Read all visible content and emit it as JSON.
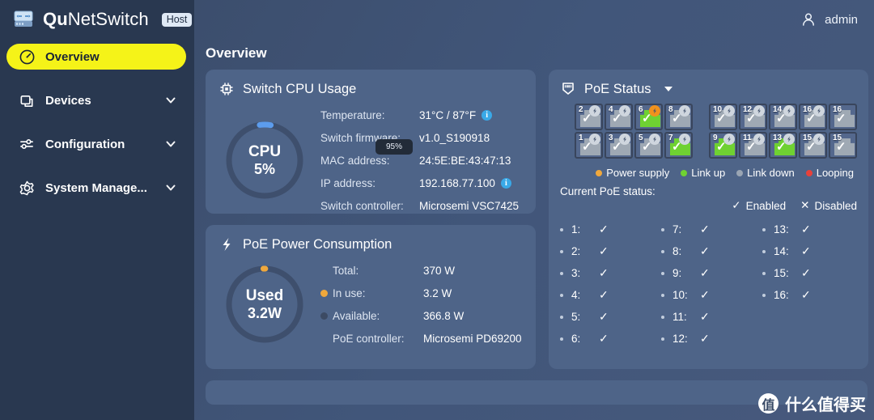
{
  "brand": {
    "name_bold": "Qu",
    "name_rest": "NetSwitch",
    "badge": "Host",
    "logo_icon": "switch-device-icon"
  },
  "sidebar": {
    "items": [
      {
        "label": "Overview",
        "icon": "gauge-icon",
        "active": true,
        "expandable": false
      },
      {
        "label": "Devices",
        "icon": "devices-icon",
        "active": false,
        "expandable": true
      },
      {
        "label": "Configuration",
        "icon": "sliders-icon",
        "active": false,
        "expandable": true
      },
      {
        "label": "System Manage...",
        "icon": "gear-icon",
        "active": false,
        "expandable": true
      }
    ]
  },
  "topbar": {
    "user": "admin",
    "user_icon": "user-icon"
  },
  "page": {
    "title": "Overview"
  },
  "cpu_card": {
    "title": "Switch CPU Usage",
    "icon": "cpu-chip-icon",
    "donut": {
      "line1": "CPU",
      "line2": "5%",
      "percent": 5,
      "arc_color": "#5c9ced",
      "track_color": "#3e4f6d"
    },
    "tooltip": "95%",
    "rows": [
      {
        "label": "Temperature:",
        "value": "31°C / 87°F",
        "info": true
      },
      {
        "label": "Switch firmware:",
        "value": "v1.0_S190918",
        "info": false
      },
      {
        "label": "MAC address:",
        "value": "24:5E:BE:43:47:13",
        "info": false
      },
      {
        "label": "IP address:",
        "value": "192.168.77.100",
        "info": true
      },
      {
        "label": "Switch controller:",
        "value": "Microsemi VSC7425",
        "info": false
      }
    ]
  },
  "poe_power_card": {
    "title": "PoE Power Consumption",
    "icon": "lightning-icon",
    "donut": {
      "line1": "Used",
      "line2": "3.2W",
      "percent": 0.86,
      "arc_color": "#f0a83c",
      "track_color": "#3e4f6d"
    },
    "rows": [
      {
        "label": "Total:",
        "value": "370 W",
        "dot": null
      },
      {
        "label": "In use:",
        "value": "3.2 W",
        "dot": "#f0a83c"
      },
      {
        "label": "Available:",
        "value": "366.8 W",
        "dot": "#3c4a63"
      },
      {
        "label": "PoE controller:",
        "value": "Microsemi PD69200",
        "dot": null
      }
    ]
  },
  "poe_status_card": {
    "title": "PoE Status",
    "icon": "rj45-port-icon",
    "has_dropdown": true,
    "ports_top_bank1": [
      {
        "num": "2",
        "state": "down",
        "bolt": true,
        "bolt_active": false,
        "check": true
      },
      {
        "num": "4",
        "state": "down",
        "bolt": true,
        "bolt_active": false,
        "check": true
      },
      {
        "num": "6",
        "state": "up",
        "bolt": true,
        "bolt_active": true,
        "check": true
      },
      {
        "num": "8",
        "state": "down",
        "bolt": true,
        "bolt_active": false,
        "check": true
      }
    ],
    "ports_bottom_bank1": [
      {
        "num": "1",
        "state": "down",
        "bolt": true,
        "bolt_active": false,
        "check": true
      },
      {
        "num": "3",
        "state": "down",
        "bolt": true,
        "bolt_active": false,
        "check": true
      },
      {
        "num": "5",
        "state": "down",
        "bolt": true,
        "bolt_active": false,
        "check": true
      },
      {
        "num": "7",
        "state": "up",
        "bolt": true,
        "bolt_active": false,
        "check": true
      }
    ],
    "ports_top_bank2": [
      {
        "num": "10",
        "state": "down",
        "bolt": true,
        "bolt_active": false,
        "check": true
      },
      {
        "num": "12",
        "state": "down",
        "bolt": true,
        "bolt_active": false,
        "check": true
      },
      {
        "num": "14",
        "state": "down",
        "bolt": true,
        "bolt_active": false,
        "check": true
      },
      {
        "num": "16",
        "state": "down",
        "bolt": true,
        "bolt_active": false,
        "check": true
      },
      {
        "num": "16",
        "state": "down",
        "bolt": false,
        "bolt_active": false,
        "check": true
      }
    ],
    "ports_bottom_bank2": [
      {
        "num": "9",
        "state": "up",
        "bolt": true,
        "bolt_active": false,
        "check": true
      },
      {
        "num": "11",
        "state": "down",
        "bolt": true,
        "bolt_active": false,
        "check": true
      },
      {
        "num": "13",
        "state": "up",
        "bolt": true,
        "bolt_active": false,
        "check": true
      },
      {
        "num": "15",
        "state": "down",
        "bolt": true,
        "bolt_active": false,
        "check": true
      },
      {
        "num": "15",
        "state": "down",
        "bolt": false,
        "bolt_active": false,
        "check": true
      }
    ],
    "legend": [
      {
        "label": "Power supply",
        "color": "#f0a83c"
      },
      {
        "label": "Link up",
        "color": "#6fd132"
      },
      {
        "label": "Link down",
        "color": "#9aa5b3"
      },
      {
        "label": "Looping",
        "color": "#e8413a"
      }
    ],
    "current_label": "Current PoE status:",
    "keys": [
      {
        "symbol": "✓",
        "label": "Enabled"
      },
      {
        "symbol": "✕",
        "label": "Disabled"
      }
    ],
    "port_status": [
      {
        "num": "1:",
        "enabled": true
      },
      {
        "num": "7:",
        "enabled": true
      },
      {
        "num": "13:",
        "enabled": true
      },
      {
        "num": "2:",
        "enabled": true
      },
      {
        "num": "8:",
        "enabled": true
      },
      {
        "num": "14:",
        "enabled": true
      },
      {
        "num": "3:",
        "enabled": true
      },
      {
        "num": "9:",
        "enabled": true
      },
      {
        "num": "15:",
        "enabled": true
      },
      {
        "num": "4:",
        "enabled": true
      },
      {
        "num": "10:",
        "enabled": true
      },
      {
        "num": "16:",
        "enabled": true
      },
      {
        "num": "5:",
        "enabled": true
      },
      {
        "num": "11:",
        "enabled": true
      },
      {
        "num": "",
        "enabled": false
      },
      {
        "num": "6:",
        "enabled": true
      },
      {
        "num": "12:",
        "enabled": true
      },
      {
        "num": "",
        "enabled": false
      }
    ]
  },
  "watermark": {
    "badge": "值",
    "text": "什么值得买"
  },
  "colors": {
    "sidebar_bg": "#293850",
    "main_bg": "#41567a",
    "card_bg": "#4e6488",
    "accent_yellow": "#f5f318",
    "link_up_green": "#6fd132",
    "power_orange": "#f0a83c",
    "info_blue": "#39a9e8"
  }
}
